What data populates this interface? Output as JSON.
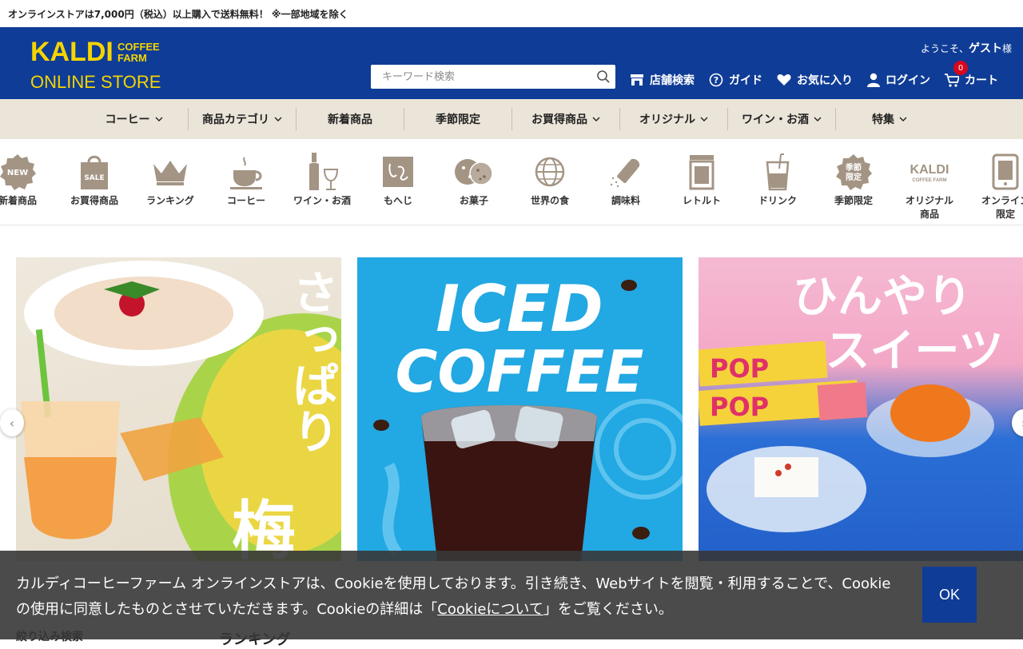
{
  "announcement": "オンラインストアは7,000円（税込）以上購入で送料無料！ ※一部地域を除く",
  "logo": {
    "line1": "KALDI",
    "line2a": "COFFEE",
    "line2b": "FARM",
    "line3": "ONLINE STORE"
  },
  "welcome": {
    "prefix": "ようこそ、",
    "name": "ゲスト",
    "suffix": "様"
  },
  "search": {
    "placeholder": "キーワード検索"
  },
  "header_nav": [
    {
      "label": "店舗検索",
      "icon": "store-icon"
    },
    {
      "label": "ガイド",
      "icon": "question-icon"
    },
    {
      "label": "お気に入り",
      "icon": "heart-icon"
    },
    {
      "label": "ログイン",
      "icon": "user-icon"
    },
    {
      "label": "カート",
      "icon": "cart-icon",
      "badge": "0"
    }
  ],
  "category_nav": [
    {
      "label": "コーヒー",
      "dropdown": true
    },
    {
      "label": "商品カテゴリ",
      "dropdown": true
    },
    {
      "label": "新着商品",
      "dropdown": false
    },
    {
      "label": "季節限定",
      "dropdown": false
    },
    {
      "label": "お買得商品",
      "dropdown": true
    },
    {
      "label": "オリジナル",
      "dropdown": true
    },
    {
      "label": "ワイン・お酒",
      "dropdown": true
    },
    {
      "label": "特集",
      "dropdown": true
    }
  ],
  "icon_row": [
    {
      "label": "新着商品",
      "icon": "new-badge-icon",
      "badge_text": "NEW"
    },
    {
      "label": "お買得商品",
      "icon": "sale-bag-icon",
      "badge_text": "SALE"
    },
    {
      "label": "ランキング",
      "icon": "crown-icon"
    },
    {
      "label": "コーヒー",
      "icon": "coffee-cup-icon"
    },
    {
      "label": "ワイン・お酒",
      "icon": "wine-icon"
    },
    {
      "label": "もへじ",
      "icon": "mohei-icon"
    },
    {
      "label": "お菓子",
      "icon": "cookie-icon"
    },
    {
      "label": "世界の食",
      "icon": "globe-icon"
    },
    {
      "label": "調味料",
      "icon": "salt-shaker-icon"
    },
    {
      "label": "レトルト",
      "icon": "retort-pouch-icon"
    },
    {
      "label": "ドリンク",
      "icon": "drink-icon"
    },
    {
      "label": "季節限定",
      "icon": "seasonal-badge-icon",
      "badge_text": "季節限定"
    },
    {
      "label": "オリジナル商品",
      "label_line1": "オリジナル",
      "label_line2": "商品",
      "icon": "kaldi-logo-icon",
      "badge_text": "KALDI",
      "badge_sub": "COFFEE FARM"
    },
    {
      "label": "オンライン限定",
      "label_line1": "オンライン",
      "label_line2": "限定",
      "icon": "smartphone-icon"
    }
  ],
  "banners": [
    {
      "title": "さっぱり梅",
      "title_line1": "さっぱり",
      "title_line2": "梅"
    },
    {
      "title": "ICED COFFEE",
      "title_line1": "ICED",
      "title_line2": "COFFEE"
    },
    {
      "title": "ひんやりスイーツ",
      "title_line1": "ひんやり",
      "title_line2": "スイーツ",
      "product_text": "POP"
    }
  ],
  "below": {
    "left": "絞り込み検索",
    "right": "ランキング"
  },
  "cookie": {
    "text_before": "カルディコーヒーファーム オンラインストアは、Cookieを使用しております。引き続き、Webサイトを閲覧・利用することで、Cookieの使用に同意したものとさせていただきます。Cookieの詳細は「",
    "link": "Cookieについて",
    "text_after": "」をご覧ください。",
    "ok": "OK"
  }
}
